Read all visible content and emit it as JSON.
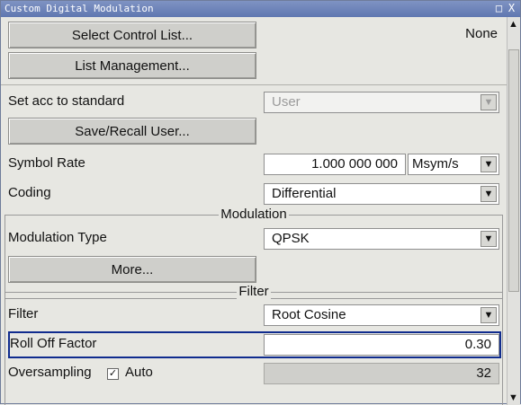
{
  "window": {
    "title": "Custom Digital Modulation",
    "restore_label": "□",
    "close_label": "X"
  },
  "top": {
    "select_button": "Select Control List...",
    "status_value": "None",
    "list_button": "List Management..."
  },
  "standard": {
    "label": "Set acc to standard",
    "value": "User",
    "save_button": "Save/Recall User..."
  },
  "symbol_rate": {
    "label": "Symbol Rate",
    "value": "1.000 000 000",
    "unit": "Msym/s"
  },
  "coding": {
    "label": "Coding",
    "value": "Differential"
  },
  "modulation": {
    "title": "Modulation",
    "type_label": "Modulation Type",
    "type_value": "QPSK",
    "more_button": "More..."
  },
  "filter": {
    "title": "Filter",
    "label": "Filter",
    "value": "Root Cosine",
    "roll_off_label": "Roll Off Factor",
    "roll_off_value": "0.30",
    "oversampling_label": "Oversampling",
    "auto_label": "Auto",
    "oversampling_value": "32"
  },
  "icons": {
    "dropdown": "▼",
    "scroll_up": "▲",
    "scroll_down": "▼",
    "check": "✓"
  }
}
